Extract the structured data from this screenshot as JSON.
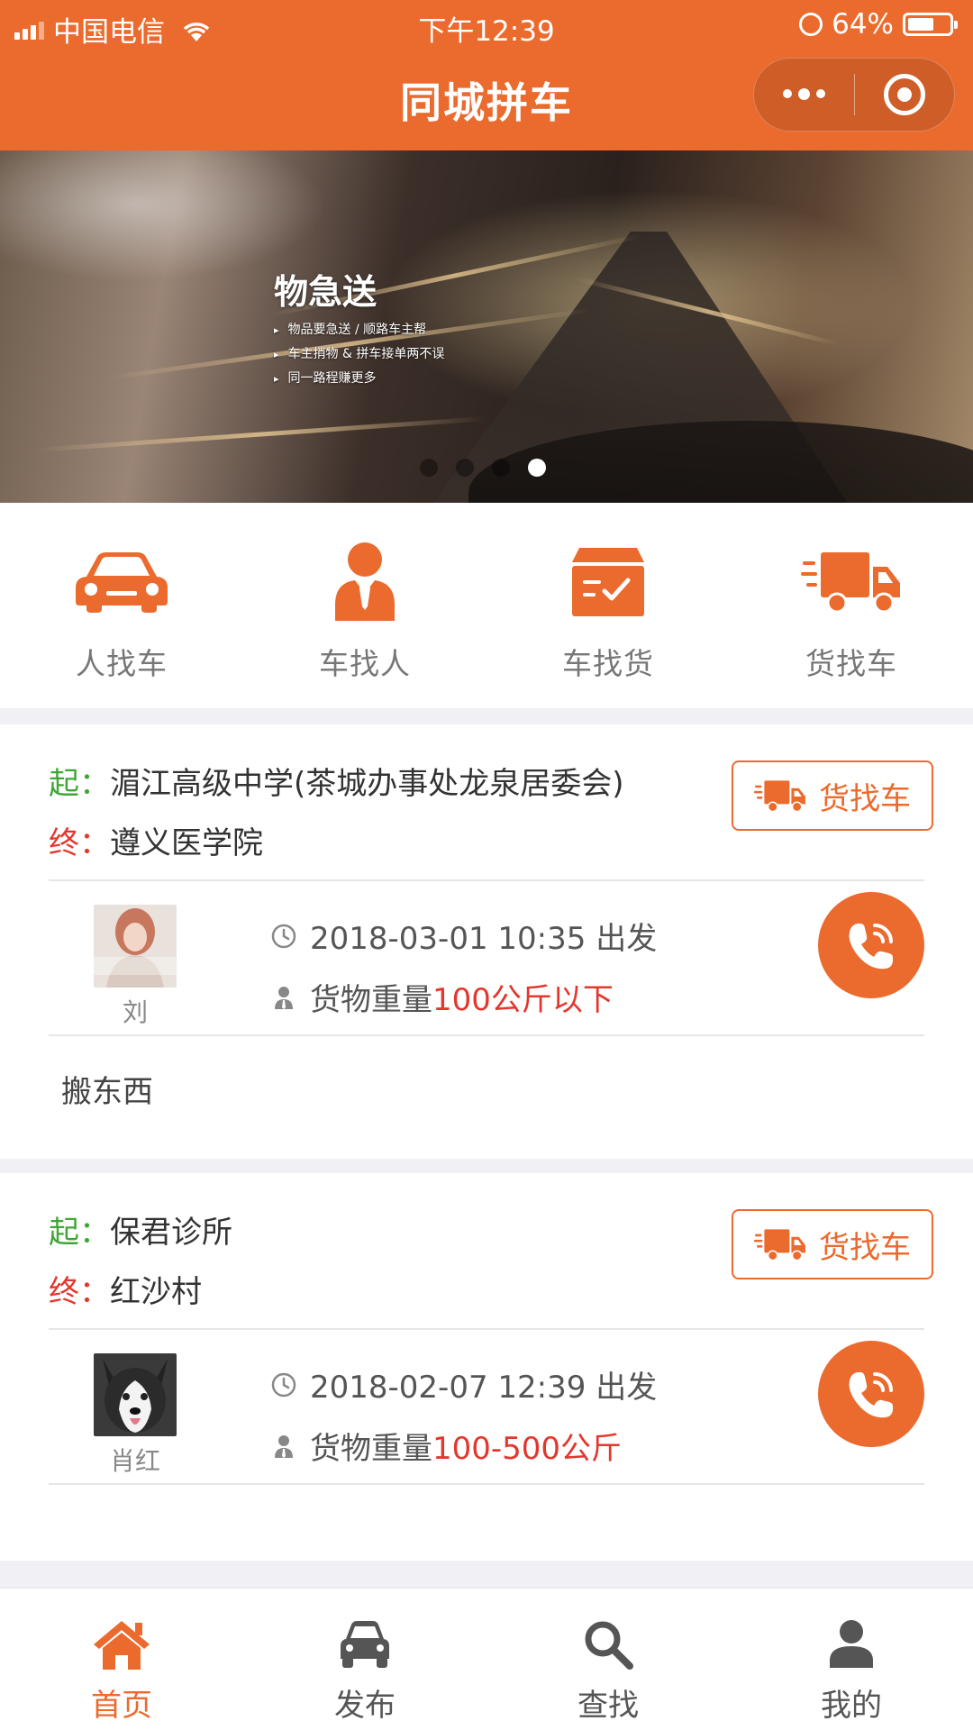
{
  "status_bar": {
    "carrier": "中国电信",
    "time": "下午12:39",
    "battery": "64%",
    "battery_level": 0.64
  },
  "nav": {
    "title": "同城拼车"
  },
  "banner": {
    "title": "物急送",
    "lines": [
      "物品要急送 / 顺路车主帮",
      "车主捎物 & 拼车接单两不误",
      "同一路程赚更多"
    ],
    "slide_count": 4,
    "active_slide": 4
  },
  "categories": [
    {
      "label": "人找车",
      "icon": "car-icon"
    },
    {
      "label": "车找人",
      "icon": "person-icon"
    },
    {
      "label": "车找货",
      "icon": "parcel-box-icon"
    },
    {
      "label": "货找车",
      "icon": "truck-icon"
    }
  ],
  "listings": [
    {
      "start_label": "起：",
      "start": "湄江高级中学(茶城办事处龙泉居委会)",
      "end_label": "终：",
      "end": "遵义医学院",
      "type": "货找车",
      "user": "刘",
      "datetime": "2018-03-01 10:35 出发",
      "weight_label": "货物重量",
      "weight": "100公斤以下",
      "note": "搬东西"
    },
    {
      "start_label": "起：",
      "start": "保君诊所",
      "end_label": "终：",
      "end": "红沙村",
      "type": "货找车",
      "user": "肖红",
      "datetime": "2018-02-07 12:39 出发",
      "weight_label": "货物重量",
      "weight": "100-500公斤",
      "note": ""
    }
  ],
  "tabs": [
    {
      "label": "首页",
      "icon": "home-icon",
      "active": true
    },
    {
      "label": "发布",
      "icon": "car-front-icon",
      "active": false
    },
    {
      "label": "查找",
      "icon": "search-icon",
      "active": false
    },
    {
      "label": "我的",
      "icon": "user-icon",
      "active": false
    }
  ],
  "colors": {
    "accent": "#eb6a2d",
    "start_green": "#3fa636",
    "end_red": "#e3372e"
  }
}
